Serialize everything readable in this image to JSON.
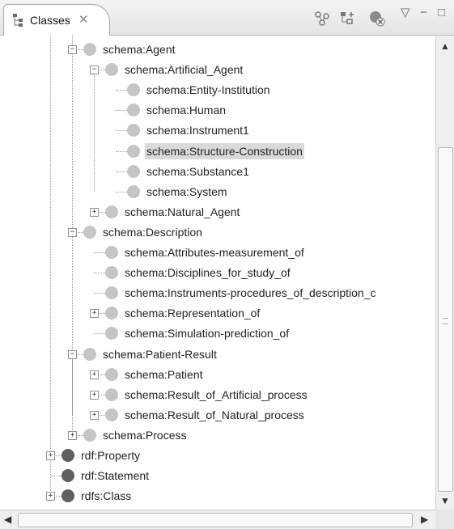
{
  "view": {
    "tab_label": "Classes",
    "tab_close_glyph": "✕",
    "tab_icon": "class-hierarchy-icon",
    "toolbar_icons": [
      "add-subclass-icon",
      "add-sibling-icon",
      "delete-class-icon"
    ],
    "menu_glyph": "▽",
    "minimize_glyph": "−",
    "maximize_glyph": "□"
  },
  "tree": {
    "nodes": [
      {
        "label": "schema:Agent",
        "depth": 2,
        "expander": "minus",
        "dot": "light"
      },
      {
        "label": "schema:Artificial_Agent",
        "depth": 3,
        "expander": "minus",
        "dot": "light"
      },
      {
        "label": "schema:Entity-Institution",
        "depth": 4,
        "expander": "none",
        "dot": "light"
      },
      {
        "label": "schema:Human",
        "depth": 4,
        "expander": "none",
        "dot": "light"
      },
      {
        "label": "schema:Instrument1",
        "depth": 4,
        "expander": "none",
        "dot": "light"
      },
      {
        "label": "schema:Structure-Construction",
        "depth": 4,
        "expander": "none",
        "dot": "light",
        "selected": true
      },
      {
        "label": "schema:Substance1",
        "depth": 4,
        "expander": "none",
        "dot": "light"
      },
      {
        "label": "schema:System",
        "depth": 4,
        "expander": "none",
        "dot": "light"
      },
      {
        "label": "schema:Natural_Agent",
        "depth": 3,
        "expander": "plus",
        "dot": "light"
      },
      {
        "label": "schema:Description",
        "depth": 2,
        "expander": "minus",
        "dot": "light"
      },
      {
        "label": "schema:Attributes-measurement_of",
        "depth": 3,
        "expander": "none",
        "dot": "light"
      },
      {
        "label": "schema:Disciplines_for_study_of",
        "depth": 3,
        "expander": "none",
        "dot": "light"
      },
      {
        "label": "schema:Instruments-procedures_of_description_c",
        "depth": 3,
        "expander": "none",
        "dot": "light"
      },
      {
        "label": "schema:Representation_of",
        "depth": 3,
        "expander": "plus",
        "dot": "light"
      },
      {
        "label": "schema:Simulation-prediction_of",
        "depth": 3,
        "expander": "none",
        "dot": "light"
      },
      {
        "label": "schema:Patient-Result",
        "depth": 2,
        "expander": "minus",
        "dot": "light"
      },
      {
        "label": "schema:Patient",
        "depth": 3,
        "expander": "plus",
        "dot": "light"
      },
      {
        "label": "schema:Result_of_Artificial_process",
        "depth": 3,
        "expander": "plus",
        "dot": "light"
      },
      {
        "label": "schema:Result_of_Natural_process",
        "depth": 3,
        "expander": "plus",
        "dot": "light"
      },
      {
        "label": "schema:Process",
        "depth": 2,
        "expander": "plus",
        "dot": "light"
      },
      {
        "label": "rdf:Property",
        "depth": 1,
        "expander": "plus",
        "dot": "dark"
      },
      {
        "label": "rdf:Statement",
        "depth": 1,
        "expander": "none",
        "dot": "dark"
      },
      {
        "label": "rdfs:Class",
        "depth": 1,
        "expander": "plus",
        "dot": "dark"
      }
    ]
  },
  "scrollbars": {
    "up_glyph": "▲",
    "down_glyph": "▼",
    "left_glyph": "◀",
    "right_glyph": "▶"
  },
  "colors": {
    "selection": "#d9d9d9",
    "class_dot": "#c5c5c5",
    "builtin_dot": "#5f5f5f"
  }
}
